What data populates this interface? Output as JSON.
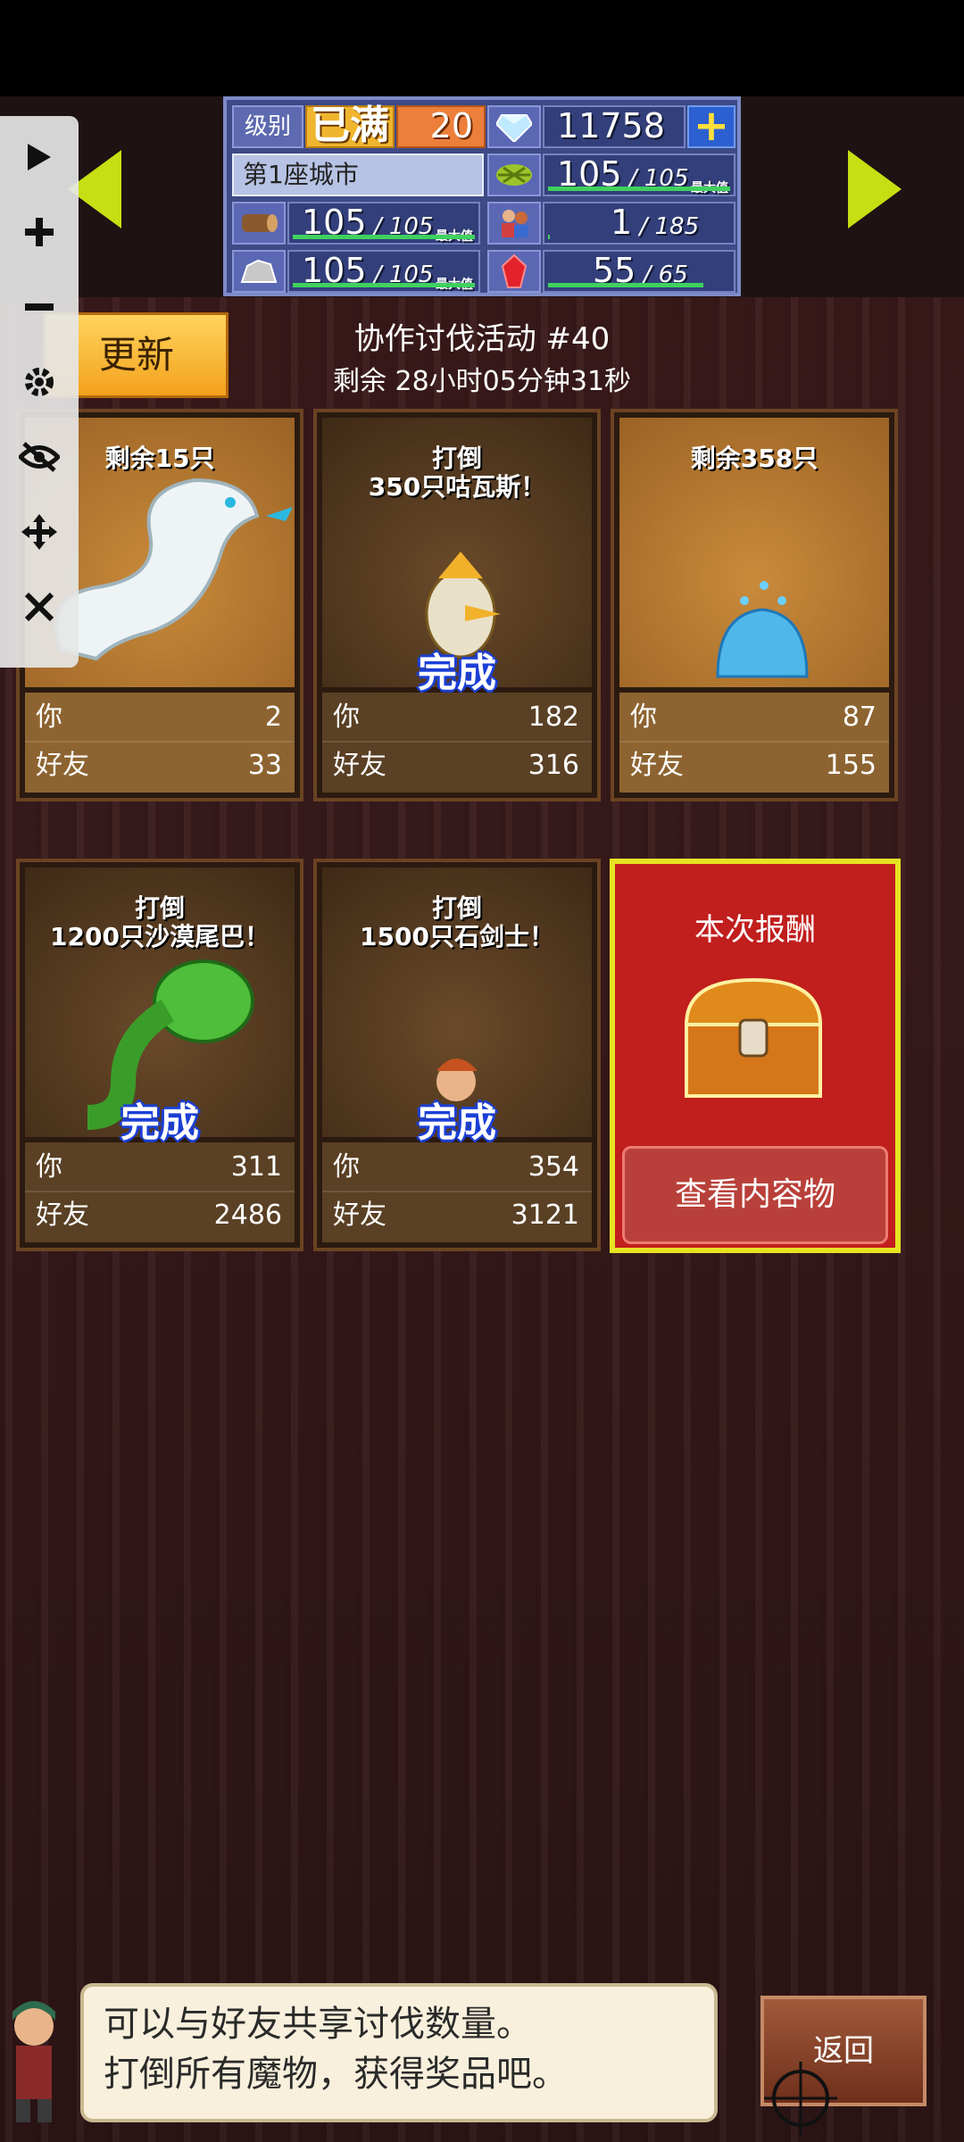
{
  "stats_panel": {
    "level_label": "级别",
    "level_badge": "已满",
    "level_value": "20",
    "gems": "11758",
    "plus_label": "+",
    "city_name": "第1座城市",
    "resources": [
      {
        "icon": "wheat-icon",
        "current": "105",
        "max": "105",
        "cap_label": "最大值",
        "fill": 1.0
      },
      {
        "icon": "wood-log-icon",
        "current": "105",
        "max": "105",
        "cap_label": "最大值",
        "fill": 1.0
      },
      {
        "icon": "population-icon",
        "current": "1",
        "max": "185",
        "cap_label": "",
        "fill": 0.01
      },
      {
        "icon": "stone-icon",
        "current": "105",
        "max": "105",
        "cap_label": "最大值",
        "fill": 1.0
      },
      {
        "icon": "ruby-icon",
        "current": "55",
        "max": "65",
        "cap_label": "",
        "fill": 0.85
      }
    ]
  },
  "toolbar": {
    "items": [
      "play-icon",
      "plus-icon",
      "minus-icon",
      "gear-icon",
      "eye-off-icon",
      "move-icon",
      "close-icon"
    ]
  },
  "header": {
    "update_label": "更新",
    "event_title": "协作讨伐活动 #40",
    "event_remaining": "剩余 28小时05分钟31秒"
  },
  "cards": [
    {
      "caption": "剩余15只",
      "status": "",
      "you_label": "你",
      "you": "2",
      "friend_label": "好友",
      "friends": "33",
      "monster": "white-serpent"
    },
    {
      "caption": "打倒\n350只咕瓦斯！",
      "status": "完成",
      "you_label": "你",
      "you": "182",
      "friend_label": "好友",
      "friends": "316",
      "monster": "bird-warrior"
    },
    {
      "caption": "剩余358只",
      "status": "",
      "you_label": "你",
      "you": "87",
      "friend_label": "好友",
      "friends": "155",
      "monster": "blue-slime"
    },
    {
      "caption": "打倒\n1200只沙漠尾巴！",
      "status": "完成",
      "you_label": "你",
      "you": "311",
      "friend_label": "好友",
      "friends": "2486",
      "monster": "green-plant"
    },
    {
      "caption": "打倒\n1500只石剑士！",
      "status": "完成",
      "you_label": "你",
      "you": "354",
      "friend_label": "好友",
      "friends": "3121",
      "monster": "stone-swordsman"
    }
  ],
  "reward": {
    "title": "本次报酬",
    "view_label": "查看内容物"
  },
  "dialog": {
    "line1": "可以与好友共享讨伐数量。",
    "line2": "打倒所有魔物，获得奖品吧。"
  },
  "back_label": "返回",
  "colors": {
    "accent_gold": "#f3a11d",
    "complete_blue": "#1b3fd6",
    "reward_red": "#c11e1e",
    "arrow_green": "#c6df12"
  }
}
